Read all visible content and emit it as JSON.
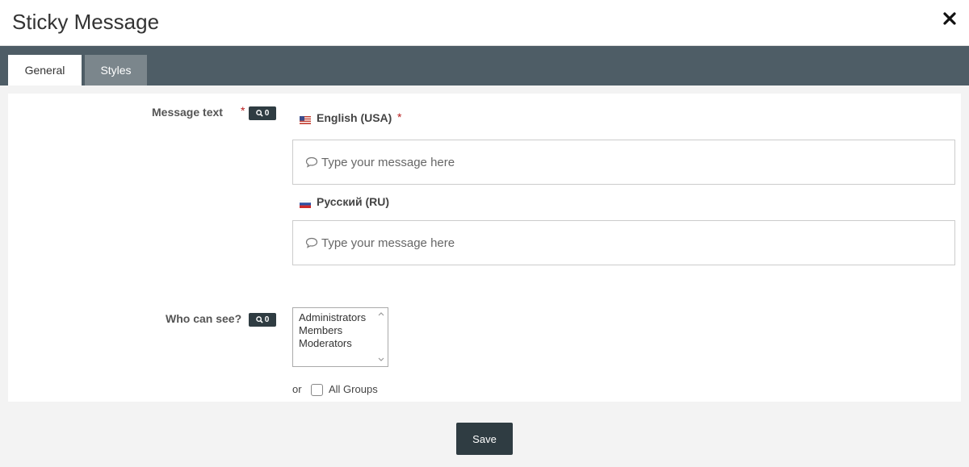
{
  "header": {
    "title": "Sticky Message",
    "close_icon": "close-icon"
  },
  "tabs": [
    {
      "label": "General",
      "active": true
    },
    {
      "label": "Styles",
      "active": false
    }
  ],
  "message_text": {
    "label": "Message text",
    "required_mark": "*",
    "badge": "0",
    "languages": [
      {
        "name": "English (USA)",
        "required": "*",
        "flag": "us-flag-icon",
        "placeholder": "Type your message here"
      },
      {
        "name": "Русский (RU)",
        "required": "",
        "flag": "ru-flag-icon",
        "placeholder": "Type your message here"
      }
    ]
  },
  "visibility": {
    "label": "Who can see?",
    "badge": "0",
    "groups": [
      "Administrators",
      "Members",
      "Moderators"
    ],
    "or_text": "or",
    "all_groups_label": "All Groups",
    "all_groups_checked": false
  },
  "footer": {
    "save_label": "Save"
  },
  "colors": {
    "tabbar": "#4e5d66",
    "dark_button": "#2f3c42",
    "required": "#b71c1c"
  }
}
